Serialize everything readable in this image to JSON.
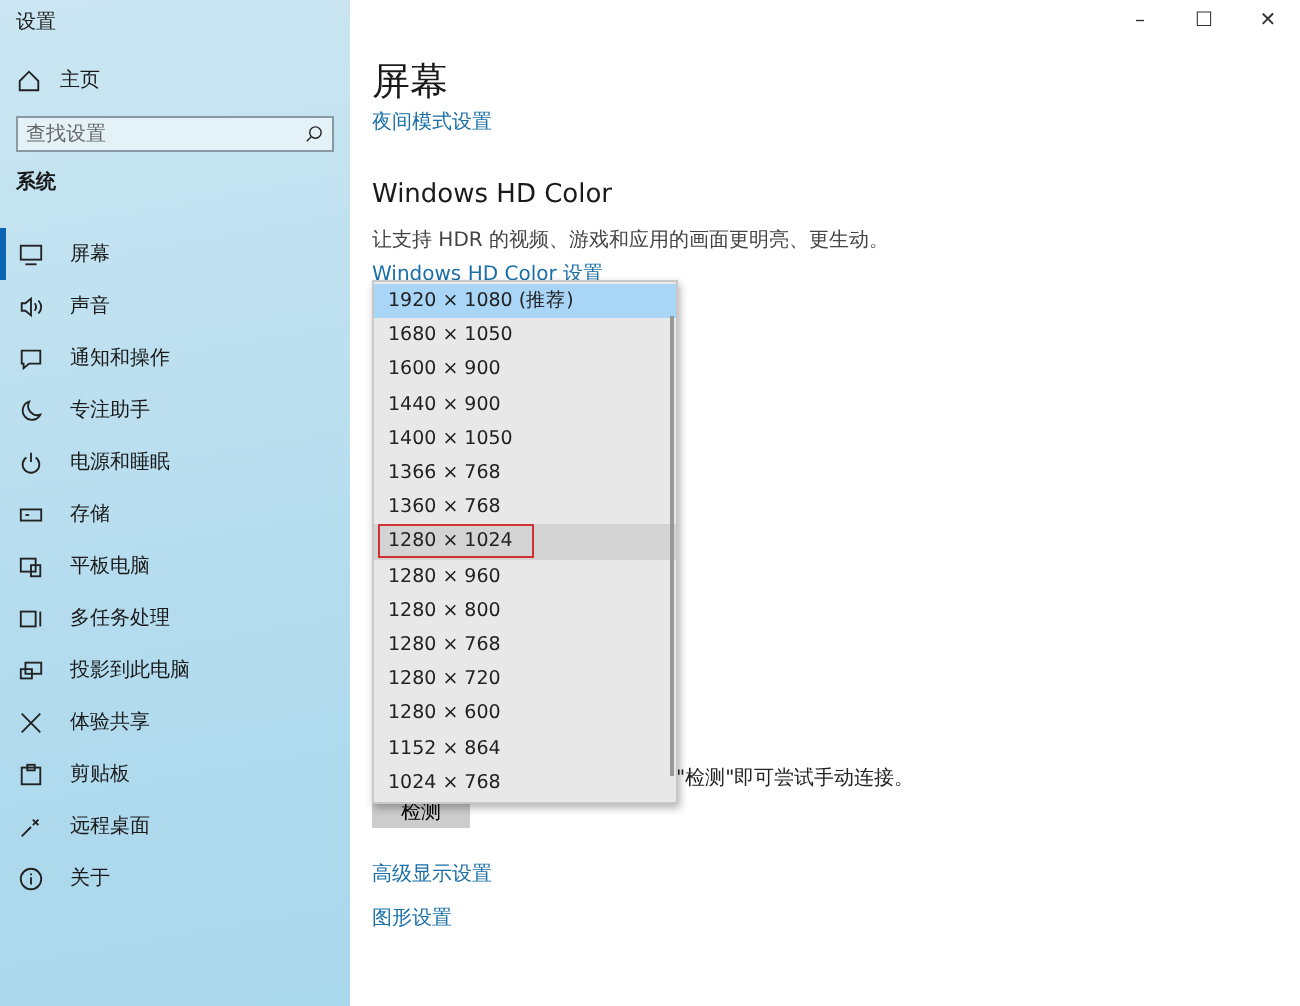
{
  "window": {
    "title": "设置",
    "controls": [
      "–",
      "☐",
      "✕"
    ]
  },
  "sidebar": {
    "home": "主页",
    "search": {
      "placeholder": "查找设置"
    },
    "section": "系统",
    "items": [
      {
        "label": "屏幕",
        "selected": true
      },
      {
        "label": "声音",
        "selected": false
      },
      {
        "label": "通知和操作",
        "selected": false
      },
      {
        "label": "专注助手",
        "selected": false
      },
      {
        "label": "电源和睡眠",
        "selected": false
      },
      {
        "label": "存储",
        "selected": false
      },
      {
        "label": "平板电脑",
        "selected": false
      },
      {
        "label": "多任务处理",
        "selected": false
      },
      {
        "label": "投影到此电脑",
        "selected": false
      },
      {
        "label": "体验共享",
        "selected": false
      },
      {
        "label": "剪贴板",
        "selected": false
      },
      {
        "label": "远程桌面",
        "selected": false
      },
      {
        "label": "关于",
        "selected": false
      }
    ]
  },
  "main": {
    "title": "屏幕",
    "night_link": "夜间模式设置",
    "hd_heading": "Windows HD Color",
    "hd_text": "让支持 HDR 的视频、游戏和应用的画面更明亮、更生动。",
    "hd_link": "Windows HD Color 设置",
    "detect_text": "\"检测\"即可尝试手动连接。",
    "detect_button": "检测",
    "links": [
      "高级显示设置",
      "图形设置"
    ]
  },
  "resolution_list": [
    {
      "label": "1920 × 1080 (推荐)",
      "selected": true,
      "hovered": false,
      "marked": false
    },
    {
      "label": "1680 × 1050",
      "selected": false,
      "hovered": false,
      "marked": false
    },
    {
      "label": "1600 × 900",
      "selected": false,
      "hovered": false,
      "marked": false
    },
    {
      "label": "1440 × 900",
      "selected": false,
      "hovered": false,
      "marked": false
    },
    {
      "label": "1400 × 1050",
      "selected": false,
      "hovered": false,
      "marked": false
    },
    {
      "label": "1366 × 768",
      "selected": false,
      "hovered": false,
      "marked": false
    },
    {
      "label": "1360 × 768",
      "selected": false,
      "hovered": false,
      "marked": false
    },
    {
      "label": "1280 × 1024",
      "selected": false,
      "hovered": true,
      "marked": true
    },
    {
      "label": "1280 × 960",
      "selected": false,
      "hovered": false,
      "marked": false
    },
    {
      "label": "1280 × 800",
      "selected": false,
      "hovered": false,
      "marked": false
    },
    {
      "label": "1280 × 768",
      "selected": false,
      "hovered": false,
      "marked": false
    },
    {
      "label": "1280 × 720",
      "selected": false,
      "hovered": false,
      "marked": false
    },
    {
      "label": "1280 × 600",
      "selected": false,
      "hovered": false,
      "marked": false
    },
    {
      "label": "1152 × 864",
      "selected": false,
      "hovered": false,
      "marked": false
    },
    {
      "label": "1024 × 768",
      "selected": false,
      "hovered": false,
      "marked": false
    }
  ]
}
